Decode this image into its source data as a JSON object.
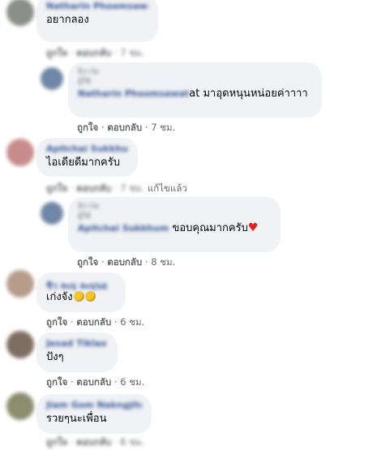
{
  "colors": {
    "bubble": "#f0f2f5",
    "name": "#385898",
    "meta": "#65676b",
    "heart": "#e02020"
  },
  "actions": {
    "like": "ถูกใจ",
    "reply": "ตอบกลับ",
    "dot": "·",
    "edited": "แก้ไขแล้ว"
  },
  "comments": [
    {
      "author": "Natharin Phoomsawat",
      "text": "อยากลอง",
      "time": "7 ชม."
    },
    {
      "author": "ธิราวัล",
      "quote_label": "ผู้ใช้",
      "quote_name": "Natharin Phoomsawat",
      "text_tail": "at มาอุดหนุนหน่อยค่าาาา",
      "time": "7 ชม."
    },
    {
      "author": "Apitchai Sukkhum",
      "text": "ไอเดียดีมากครับ",
      "time": "7 ชม."
    },
    {
      "author": "ธิราวัล",
      "quote_label": "ผู้ใช้",
      "quote_name": "Apitchai Sukkhum",
      "text_tail": "ขอบคุณมากครับ",
      "time": "8 ชม."
    },
    {
      "author": "ชิว ละมุ ละมุนอ",
      "text": "เก่งจัง",
      "time": "6 ชม."
    },
    {
      "author": "Jesad Tiklao",
      "text": "ปังๆ",
      "time": "6 ชม."
    },
    {
      "author": "Jiam Gom Nakngjita",
      "text": "รวยๆนะเพื่อน",
      "time": "6 ชม."
    }
  ],
  "icons": [
    "avatar",
    "clap-emoji-icon",
    "heart-icon"
  ]
}
